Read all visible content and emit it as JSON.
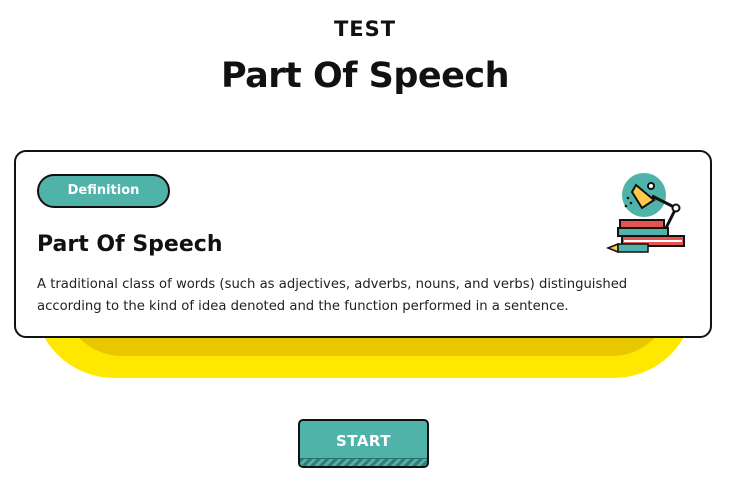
{
  "header": {
    "eyebrow": "TEST",
    "title_part1": "Part ",
    "title_highlight": "Of Speech"
  },
  "card": {
    "badge_label": "Definition",
    "heading": "Part Of Speech",
    "description": "A traditional class of words (such as adjectives, adverbs, nouns, and verbs) distinguished according to the kind of idea denoted and the function performed in a sentence.",
    "illustration_icon": "desk-lamp-books-icon"
  },
  "actions": {
    "start_label": "START"
  },
  "colors": {
    "accent_teal": "#4fb3a9",
    "highlight_yellow": "#ffe600",
    "card_border": "#111111"
  }
}
